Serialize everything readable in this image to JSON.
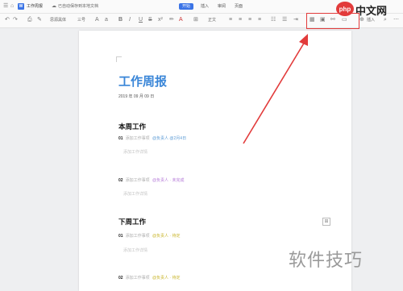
{
  "titlebar": {
    "doc_title": "工作周报",
    "doc_icon": "W",
    "save_status": "已自动保存到本地文档",
    "tabs": [
      {
        "label": "开始",
        "active": true
      },
      {
        "label": "插入",
        "active": false
      },
      {
        "label": "审阅",
        "active": false
      },
      {
        "label": "页面",
        "active": false
      }
    ]
  },
  "toolbar": {
    "font_name": "思源黑体",
    "font_size": "三号",
    "insert_label": "插入",
    "style_label": "正文"
  },
  "document": {
    "title": "工作周报",
    "date": "2019 年 09 月 09 日",
    "sections": [
      {
        "heading": "本周工作",
        "items": [
          {
            "num": "01",
            "text": "添加工作事项",
            "tag": "@负责人 @2月4日",
            "tag_color": "#5b9bd5",
            "sub": "添加工作详情"
          },
          {
            "num": "02",
            "text": "添加工作事项",
            "tag": "@负责人 · 未完成",
            "tag_color": "#b57ad8",
            "sub": "添加工作详情"
          }
        ]
      },
      {
        "heading": "下周工作",
        "items": [
          {
            "num": "01",
            "text": "添加工作事项",
            "tag": "@负责人 · 待定",
            "tag_color": "#d4c23a",
            "sub": "添加工作详情"
          },
          {
            "num": "02",
            "text": "添加工作事项",
            "tag": "@负责人 · 待定",
            "tag_color": "#d4c23a",
            "sub": ""
          }
        ]
      }
    ]
  },
  "overlay": {
    "logo_text": "php中文网",
    "watermark": "软件技巧",
    "highlight_color": "#e23b3b"
  }
}
